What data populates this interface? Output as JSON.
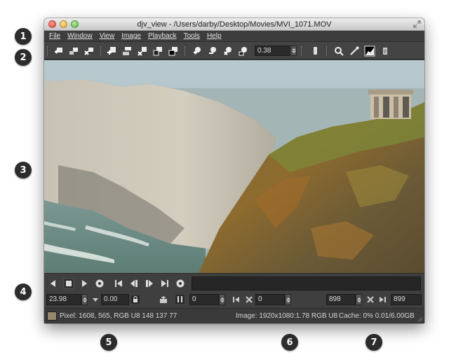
{
  "window": {
    "title": "djv_view - /Users/darby/Desktop/Movies/MVI_1071.MOV"
  },
  "menu": {
    "items": [
      "File",
      "Window",
      "View",
      "Image",
      "Playback",
      "Tools",
      "Help"
    ]
  },
  "toolbar": {
    "zoom_value": "0.38",
    "icons": [
      "new-window-icon",
      "copy-window-icon",
      "close-window-icon",
      "fit-icon",
      "fill-icon",
      "center-icon",
      "reset-icon",
      "frame-icon",
      "zoom-in-icon",
      "zoom-out-icon",
      "zoom-reset-icon",
      "zoom-fit-icon",
      "mirror-icon",
      "magnify-icon",
      "color-picker-icon",
      "histogram-icon",
      "info-icon"
    ]
  },
  "playback": {
    "icons": [
      "reverse-icon",
      "stop-icon",
      "forward-icon",
      "loop-icon",
      "start-icon",
      "prev-frame-icon",
      "next-frame-icon",
      "end-icon",
      "every-frame-icon"
    ]
  },
  "controls": {
    "fps": "23.98",
    "speed": "0.00",
    "current_frame": "0",
    "in_point": "0",
    "out_point": "898",
    "end_frame": "899"
  },
  "status": {
    "pixel": "Pixel: 1608, 565, RGB U8 148 137 77",
    "image": "Image: 1920x1080:1.78 RGB U8",
    "cache": "Cache: 0% 0.01/6.00GB",
    "pixel_swatch_color": "#94896d"
  },
  "callouts": [
    "1",
    "2",
    "3",
    "4",
    "5",
    "6",
    "7"
  ]
}
